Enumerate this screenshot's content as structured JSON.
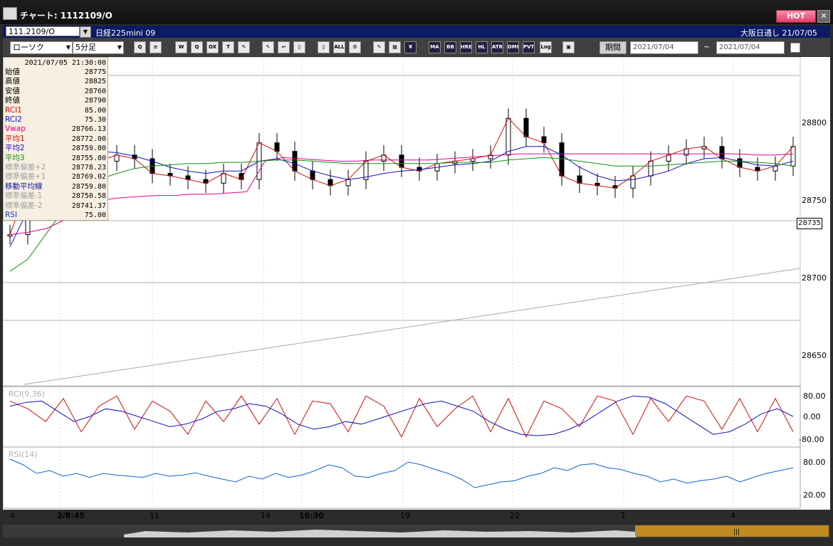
{
  "window": {
    "title": "チャート: 1112109/O",
    "hot_label": "HOT",
    "close_label": "✕"
  },
  "symbol_row": {
    "symbol_code": "111.2109/O",
    "symbol_name": "日経225mini 09",
    "market_label": "大阪日通し  21/07/05"
  },
  "toolbar": {
    "chart_type": "ローソク",
    "interval": "5分足",
    "buttons": [
      "Q",
      "≡",
      "W",
      "Q",
      "OX",
      "T",
      "✎",
      "↖",
      "↩",
      "▯",
      "▯",
      "ALL",
      "⚙",
      "✎",
      "▦",
      "¥",
      "MA",
      "BB",
      "HRE",
      "HL",
      "ATR",
      "DMI",
      "PVT",
      "Log",
      "▣"
    ],
    "period_label": "期間",
    "date_from": "2021/07/04",
    "date_to": "2021/07/04",
    "tilde": "~"
  },
  "info_panel": {
    "datetime": "2021/07/05 21:30:00",
    "rows": [
      {
        "label": "始値",
        "value": "28775",
        "color": "#000000"
      },
      {
        "label": "高値",
        "value": "28825",
        "color": "#000000"
      },
      {
        "label": "安値",
        "value": "28760",
        "color": "#000000"
      },
      {
        "label": "終値",
        "value": "28790",
        "color": "#000000"
      },
      {
        "label": "RCI1",
        "value": "85.00",
        "color": "#d01010"
      },
      {
        "label": "RCI2",
        "value": "75.30",
        "color": "#1010c0"
      },
      {
        "label": "Vwap",
        "value": "28766.13",
        "color": "#e0008c"
      },
      {
        "label": "平均1",
        "value": "28772.00",
        "color": "#d01010"
      },
      {
        "label": "平均2",
        "value": "28759.80",
        "color": "#1010c0"
      },
      {
        "label": "平均3",
        "value": "28755.80",
        "color": "#109010"
      },
      {
        "label": "標準偏差+2",
        "value": "28778.23",
        "color": "#a0a0a0"
      },
      {
        "label": "標準偏差+1",
        "value": "28769.02",
        "color": "#a0a0a0"
      },
      {
        "label": "移動平均線",
        "value": "28759.80",
        "color": "#1010a0"
      },
      {
        "label": "標準偏差-1",
        "value": "28750.58",
        "color": "#a0a0a0"
      },
      {
        "label": "標準偏差-2",
        "value": "28741.37",
        "color": "#a0a0a0"
      },
      {
        "label": "RSI",
        "value": "75.00",
        "color": "#1040d0"
      }
    ]
  },
  "price_axis": {
    "labels": [
      "28800",
      "28750",
      "28700",
      "28650"
    ],
    "current_price": "28735"
  },
  "rci_panel": {
    "title": "RCI(9,36)",
    "labels": [
      "80.00",
      "0.00",
      "-80.00"
    ]
  },
  "rsi_panel": {
    "title": "RSI(14)",
    "labels": [
      "80.00",
      "20.00"
    ]
  },
  "x_axis": {
    "labels": [
      "4",
      "2/8:45",
      "11",
      "14",
      "16:30",
      "19",
      "22",
      "1",
      "4"
    ]
  },
  "colors": {
    "rci1": "#d01010",
    "rci2": "#1010c0",
    "vwap": "#e0008c",
    "ma1": "#d01010",
    "ma2": "#1010c0",
    "ma3": "#109010",
    "band": "#a0a0a0",
    "rsi": "#1060d0",
    "hot": "#e0406a"
  },
  "chart_data": [
    {
      "type": "line",
      "title": "",
      "ylim": [
        28630,
        28830
      ],
      "series": [
        {
          "name": "Vwap",
          "values": [
            28700,
            28702,
            28705,
            28712,
            28725,
            28728,
            28730,
            28731,
            28732,
            28732,
            28733,
            28733,
            28734,
            28735,
            28760,
            28763,
            28762,
            28761,
            28760,
            28760,
            28761,
            28761,
            28761,
            28761,
            28762,
            28763,
            28764,
            28765,
            28766,
            28766,
            28766,
            28766,
            28766,
            28766,
            28766,
            28766,
            28766,
            28766,
            28766,
            28766,
            28766,
            28765,
            28765,
            28766
          ]
        },
        {
          "name": "平均1",
          "values": [
            28700,
            28740,
            28770,
            28778,
            28770,
            28760,
            28765,
            28762,
            28750,
            28748,
            28745,
            28742,
            28750,
            28745,
            28775,
            28768,
            28752,
            28745,
            28740,
            28745,
            28760,
            28765,
            28755,
            28752,
            28758,
            28760,
            28762,
            28765,
            28795,
            28780,
            28775,
            28748,
            28742,
            28740,
            28738,
            28748,
            28760,
            28765,
            28770,
            28772,
            28762,
            28755,
            28752,
            28756,
            28772
          ]
        },
        {
          "name": "平均2",
          "values": [
            28690,
            28720,
            28750,
            28765,
            28768,
            28768,
            28767,
            28764,
            28760,
            28755,
            28752,
            28750,
            28752,
            28752,
            28760,
            28762,
            28758,
            28752,
            28748,
            28745,
            28747,
            28750,
            28752,
            28753,
            28755,
            28757,
            28758,
            28760,
            28768,
            28772,
            28772,
            28765,
            28755,
            28748,
            28744,
            28745,
            28748,
            28752,
            28758,
            28762,
            28763,
            28760,
            28757,
            28756,
            28760
          ]
        },
        {
          "name": "平均3",
          "values": [
            28670,
            28680,
            28700,
            28720,
            28735,
            28745,
            28750,
            28754,
            28756,
            28757,
            28758,
            28758,
            28759,
            28759,
            28760,
            28761,
            28761,
            28760,
            28759,
            28758,
            28758,
            28758,
            28758,
            28758,
            28758,
            28759,
            28759,
            28759,
            28761,
            28762,
            28763,
            28762,
            28760,
            28758,
            28756,
            28756,
            28756,
            28757,
            28758,
            28759,
            28760,
            28760,
            28759,
            28758,
            28756
          ]
        }
      ]
    },
    {
      "type": "line",
      "title": "RCI(9,36)",
      "ylim": [
        -100,
        100
      ],
      "series": [
        {
          "name": "RCI1",
          "values": [
            60,
            30,
            -20,
            70,
            -60,
            40,
            80,
            -50,
            60,
            20,
            -70,
            60,
            -20,
            80,
            -30,
            70,
            -70,
            60,
            50,
            -60,
            80,
            40,
            -80,
            70,
            -40,
            30,
            80,
            -60,
            70,
            -80,
            60,
            30,
            -40,
            80,
            60,
            -70,
            70,
            -20,
            80,
            60,
            -50,
            70,
            -60,
            70,
            -60
          ]
        },
        {
          "name": "RCI2",
          "values": [
            40,
            55,
            60,
            20,
            -20,
            0,
            30,
            20,
            0,
            -20,
            -40,
            -30,
            -10,
            20,
            30,
            50,
            40,
            10,
            -30,
            -50,
            -40,
            -20,
            -30,
            -10,
            10,
            30,
            50,
            60,
            40,
            20,
            -20,
            -50,
            -70,
            -75,
            -70,
            -50,
            -20,
            20,
            60,
            80,
            75,
            50,
            10,
            -30,
            -70,
            -60,
            -30,
            10,
            30,
            0
          ]
        }
      ]
    },
    {
      "type": "line",
      "title": "RSI(14)",
      "ylim": [
        0,
        100
      ],
      "series": [
        {
          "name": "RSI",
          "values": [
            80,
            70,
            55,
            60,
            50,
            55,
            48,
            55,
            52,
            50,
            48,
            55,
            50,
            52,
            56,
            50,
            45,
            40,
            50,
            45,
            55,
            48,
            52,
            60,
            70,
            65,
            50,
            48,
            55,
            60,
            75,
            70,
            62,
            55,
            45,
            30,
            35,
            40,
            42,
            50,
            55,
            65,
            60,
            70,
            72,
            65,
            62,
            55,
            50,
            40,
            45,
            38,
            42,
            45,
            50,
            40,
            48,
            55,
            60,
            65
          ]
        }
      ]
    }
  ]
}
